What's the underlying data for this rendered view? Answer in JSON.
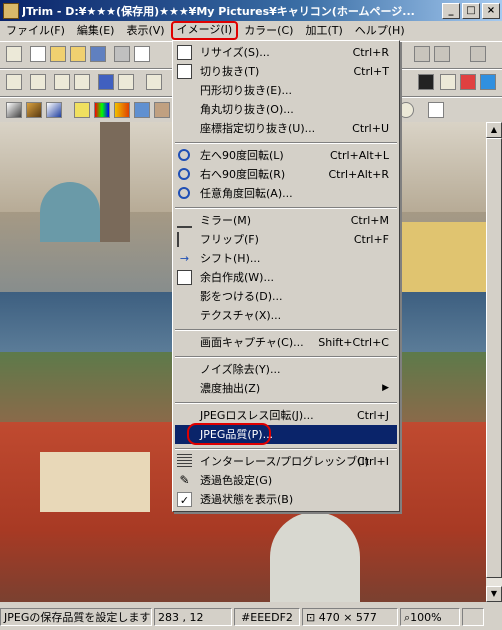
{
  "window": {
    "title": "JTrim - D:¥★★★(保存用)★★★¥My Pictures¥キャリコン(ホームページ...",
    "min": "_",
    "max": "□",
    "close": "×"
  },
  "menubar": [
    "ファイル(F)",
    "編集(E)",
    "表示(V)",
    "イメージ(I)",
    "カラー(C)",
    "加工(T)",
    "ヘルプ(H)"
  ],
  "menu": {
    "items": [
      {
        "label": "リサイズ(S)...",
        "shortcut": "Ctrl+R",
        "icon": "resize-icon"
      },
      {
        "label": "切り抜き(T)",
        "shortcut": "Ctrl+T",
        "icon": "crop-icon"
      },
      {
        "label": "円形切り抜き(E)...",
        "shortcut": "",
        "icon": ""
      },
      {
        "label": "角丸切り抜き(O)...",
        "shortcut": "",
        "icon": ""
      },
      {
        "label": "座標指定切り抜き(U)...",
        "shortcut": "Ctrl+U",
        "icon": ""
      },
      {
        "label": "左へ90度回転(L)",
        "shortcut": "Ctrl+Alt+L",
        "icon": "rotate-left-icon"
      },
      {
        "label": "右へ90度回転(R)",
        "shortcut": "Ctrl+Alt+R",
        "icon": "rotate-right-icon"
      },
      {
        "label": "任意角度回転(A)...",
        "shortcut": "",
        "icon": "rotate-any-icon"
      },
      {
        "label": "ミラー(M)",
        "shortcut": "Ctrl+M",
        "icon": "mirror-icon"
      },
      {
        "label": "フリップ(F)",
        "shortcut": "Ctrl+F",
        "icon": "flip-icon"
      },
      {
        "label": "シフト(H)...",
        "shortcut": "",
        "icon": "shift-icon"
      },
      {
        "label": "余白作成(W)...",
        "shortcut": "",
        "icon": "margin-icon"
      },
      {
        "label": "影をつける(D)...",
        "shortcut": "",
        "icon": ""
      },
      {
        "label": "テクスチャ(X)...",
        "shortcut": "",
        "icon": ""
      },
      {
        "label": "画面キャプチャ(C)...",
        "shortcut": "Shift+Ctrl+C",
        "icon": ""
      },
      {
        "label": "ノイズ除去(Y)...",
        "shortcut": "",
        "icon": ""
      },
      {
        "label": "濃度抽出(Z)",
        "shortcut": "▶",
        "icon": ""
      },
      {
        "label": "JPEGロスレス回転(J)...",
        "shortcut": "Ctrl+J",
        "icon": ""
      },
      {
        "label": "JPEG品質(P)...",
        "shortcut": "",
        "icon": ""
      },
      {
        "label": "インターレース/プログレッシブ(I)",
        "shortcut": "Ctrl+I",
        "icon": "interlace-icon"
      },
      {
        "label": "透過色設定(G)",
        "shortcut": "",
        "icon": "eyedropper-icon"
      },
      {
        "label": "透過状態を表示(B)",
        "shortcut": "",
        "icon": "check-icon"
      }
    ]
  },
  "status": {
    "message": "JPEGの保存品質を設定します",
    "coords": "283 , 12",
    "color": "#EEEDF2",
    "size": "470 × 577",
    "zoom": "100%"
  }
}
